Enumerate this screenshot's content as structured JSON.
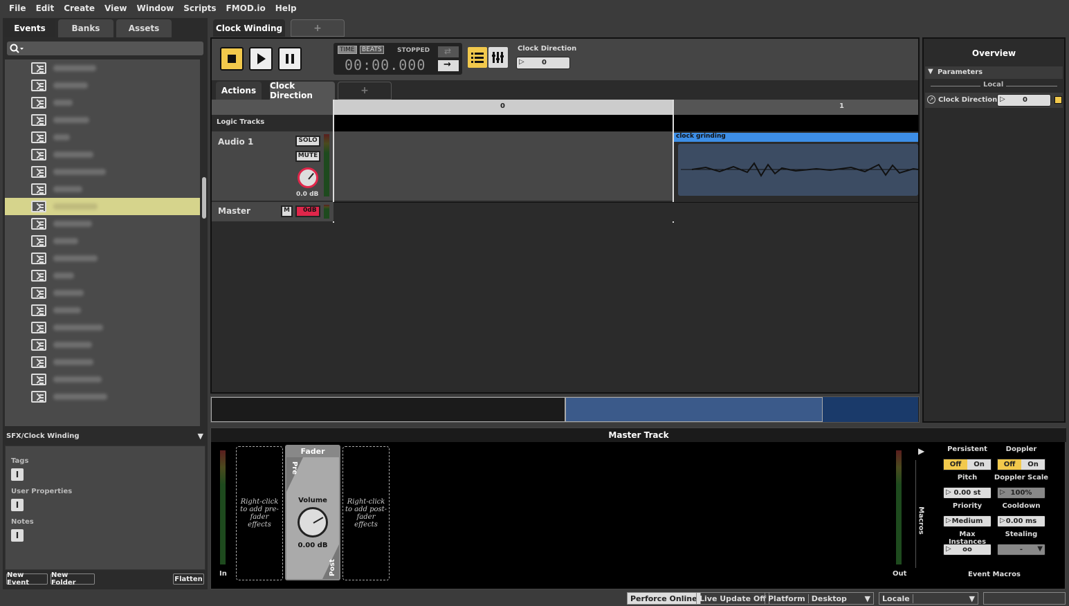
{
  "menu": [
    "File",
    "Edit",
    "Create",
    "View",
    "Window",
    "Scripts",
    "FMOD.io",
    "Help"
  ],
  "left_tabs": [
    "Events",
    "Banks",
    "Assets"
  ],
  "browser": {
    "selected_index": 8,
    "path": "SFX/Clock Winding",
    "sections": {
      "tags": "Tags",
      "user_props": "User Properties",
      "notes": "Notes"
    },
    "buttons": {
      "new_event": "New Event",
      "new_folder": "New Folder",
      "flatten": "Flatten"
    }
  },
  "editor_tabs": {
    "active": "Clock Winding",
    "add": "+"
  },
  "transport": {
    "time_tag": "TIME",
    "beats_tag": "BEATS",
    "state": "STOPPED",
    "time": "00:00.000",
    "param_label": "Clock Direction",
    "param_value": "0"
  },
  "sub_tabs": {
    "actions": "Actions",
    "clock_direction": "Clock Direction",
    "add": "+"
  },
  "ruler": {
    "mark0": "0",
    "mark1": "1"
  },
  "tracks": {
    "logic": "Logic Tracks",
    "audio_name": "Audio 1",
    "solo": "SOLO",
    "mute": "MUTE",
    "audio_vol": "0.0 dB",
    "region_name": "clock grinding",
    "master_name": "Master",
    "master_m": "M",
    "master_vol": "0dB"
  },
  "overview": {
    "title": "Overview",
    "section": "Parameters",
    "local": "Local",
    "param_name": "Clock Direction",
    "param_value": "0"
  },
  "master": {
    "title": "Master Track",
    "pre_slot": "Right-click to add pre-fader effects",
    "post_slot": "Right-click to add post-fader effects",
    "fader_title": "Fader",
    "pre": "Pre",
    "post": "Post",
    "volume_label": "Volume",
    "volume_value": "0.00 dB",
    "in": "In",
    "out": "Out",
    "macros_vertical": "Macros",
    "event_macros": "Event Macros",
    "macros": {
      "persistent": "Persistent",
      "doppler": "Doppler",
      "off": "Off",
      "on": "On",
      "pitch": "Pitch",
      "pitch_val": "0.00 st",
      "doppler_scale": "Doppler Scale",
      "doppler_scale_val": "100%",
      "priority": "Priority",
      "priority_val": "Medium",
      "cooldown": "Cooldown",
      "cooldown_val": "0.00 ms",
      "max_instances": "Max Instances",
      "max_instances_val": "oo",
      "stealing": "Stealing",
      "stealing_val": "-"
    }
  },
  "status": {
    "perforce": "Perforce Online",
    "live_update": "Live Update Off",
    "platform_label": "Platform",
    "platform_value": "Desktop",
    "locale_label": "Locale"
  },
  "colors": {
    "accent": "#f2c94c",
    "region": "#3d8ee6",
    "selection": "#d6d48c",
    "mute_red": "#e0264a"
  }
}
